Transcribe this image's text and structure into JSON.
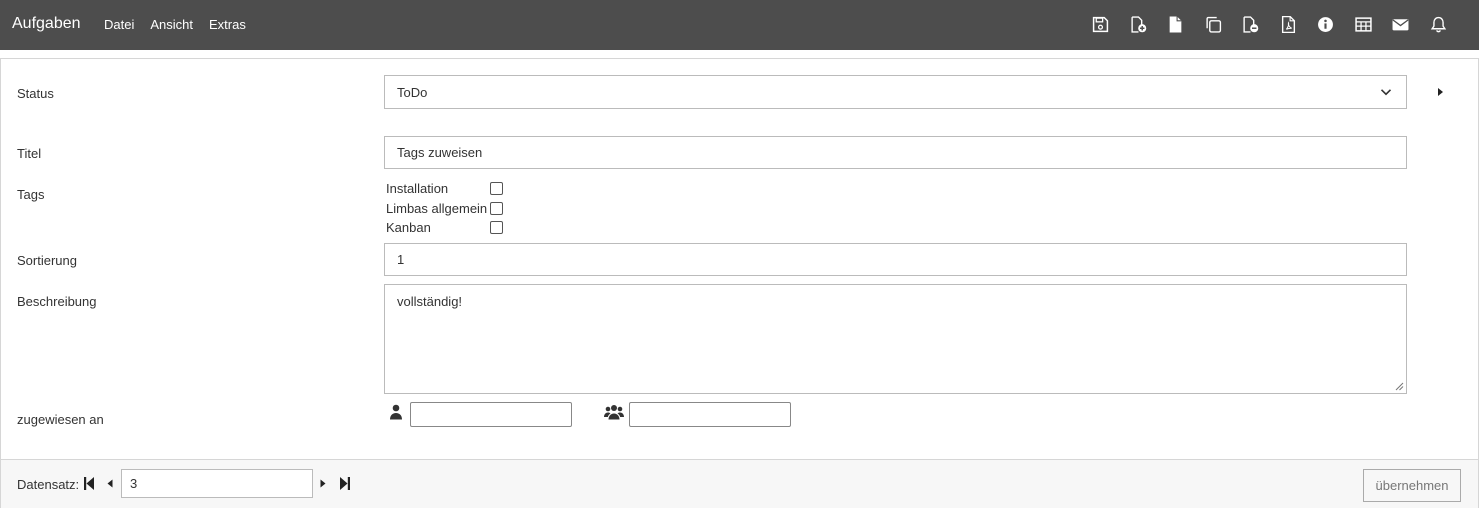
{
  "app": {
    "title": "Aufgaben"
  },
  "menu": {
    "items": [
      "Datei",
      "Ansicht",
      "Extras"
    ]
  },
  "toolbar": {
    "icons": [
      "save-icon",
      "new-record-icon",
      "file-icon",
      "copy-icon",
      "delete-record-icon",
      "pdf-icon",
      "info-icon",
      "table-icon",
      "mail-icon",
      "bell-icon"
    ]
  },
  "form": {
    "status": {
      "label": "Status",
      "value": "ToDo"
    },
    "titel": {
      "label": "Titel",
      "value": "Tags zuweisen"
    },
    "tags": {
      "label": "Tags",
      "options": [
        {
          "label": "Installation",
          "checked": false
        },
        {
          "label": "Limbas allgemein",
          "checked": false
        },
        {
          "label": "Kanban",
          "checked": false
        }
      ]
    },
    "sortierung": {
      "label": "Sortierung",
      "value": "1"
    },
    "beschreibung": {
      "label": "Beschreibung",
      "value": "vollständig!"
    },
    "zugewiesen": {
      "label": "zugewiesen an",
      "user_value": "",
      "group_value": ""
    }
  },
  "footer": {
    "record_label": "Datensatz:",
    "record_value": "3",
    "apply_label": "übernehmen"
  },
  "colors": {
    "topbar": "#4d4d4d",
    "icon": "#ffffff",
    "border": "#d6d6d6"
  }
}
